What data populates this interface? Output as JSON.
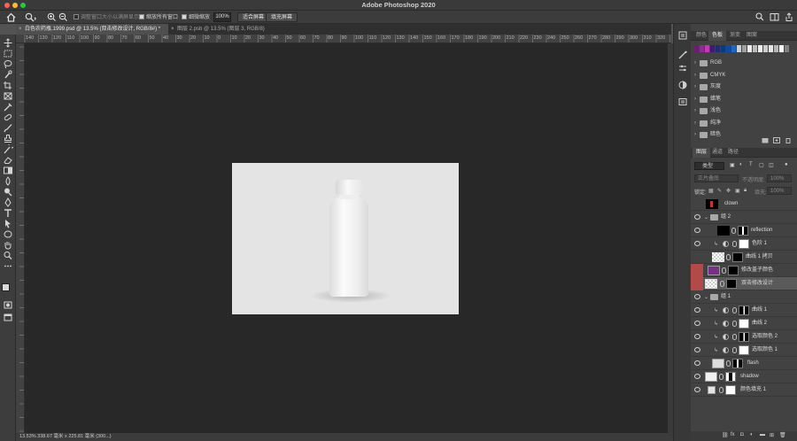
{
  "window": {
    "title": "Adobe Photoshop 2020"
  },
  "options": {
    "check1": "调整窗口大小以满屏显示",
    "check2": "缩放所有窗口",
    "check3": "细微缩放",
    "zoom_value": "100%",
    "fit_screen": "适合屏幕",
    "fill_screen": "填充屏幕"
  },
  "tabs": [
    {
      "label": "白色农药瓶.1999.psd @ 13.5% (双击修改设计, RGB/8#) *"
    },
    {
      "label": "图层 2.psb @ 13.5% (图层 3, RGB/8)"
    }
  ],
  "ruler_labels": [
    "140",
    "130",
    "120",
    "110",
    "100",
    "90",
    "80",
    "70",
    "60",
    "50",
    "40",
    "30",
    "20",
    "10",
    "0",
    "10",
    "20",
    "30",
    "40",
    "50",
    "60",
    "70",
    "80",
    "90",
    "100",
    "110",
    "120",
    "130",
    "140",
    "150",
    "160",
    "170",
    "180",
    "190",
    "200",
    "210",
    "220",
    "230",
    "240",
    "250",
    "260",
    "270",
    "280",
    "290",
    "300",
    "310",
    "320",
    "330"
  ],
  "status": {
    "text": "13.53%  338.67 毫米 x 225.81 毫米 (300...)"
  },
  "swatch_panel": {
    "tabs": [
      "颜色",
      "色板",
      "渐变",
      "图案"
    ],
    "active_tab": "色板",
    "colors": [
      "#6a1f6e",
      "#8a2f92",
      "#c33ab3",
      "#3a1f6e",
      "#1f2f6e",
      "#0a3a7a",
      "#0f4aa0",
      "#1f6ac0",
      "#d0d0d0",
      "#a0a0a0",
      "#eeeeee",
      "#bbbbbb",
      "#f0f0f0",
      "#cccccc",
      "#e6e6e6",
      "#b5b5b5",
      "#ffffff",
      "#808080"
    ],
    "groups": [
      "RGB",
      "CMYK",
      "灰度",
      "蜡笔",
      "浅色",
      "纯净",
      "暗色"
    ]
  },
  "layers_panel": {
    "tabs": [
      "图层",
      "通道",
      "路径"
    ],
    "active_tab": "图层",
    "filter_kind": "类型",
    "blend_mode": "正片叠底",
    "opacity_label": "不透明度:",
    "opacity_value": "100%",
    "lock_label": "锁定:",
    "fill_label": "填充:",
    "fill_value": "100%",
    "layers": [
      {
        "name": "clown"
      },
      {
        "name": "组 2"
      },
      {
        "name": "reflection"
      },
      {
        "name": "色阶 1"
      },
      {
        "name": "曲线 1 拷贝"
      },
      {
        "name": "修改盖子颜色"
      },
      {
        "name": "双击修改设计"
      },
      {
        "name": "组 1"
      },
      {
        "name": "曲线 1"
      },
      {
        "name": "曲线 2"
      },
      {
        "name": "选取颜色 2"
      },
      {
        "name": "选取颜色 1"
      },
      {
        "name": "flash"
      },
      {
        "name": "shadow"
      },
      {
        "name": "颜色填充 1"
      }
    ]
  }
}
